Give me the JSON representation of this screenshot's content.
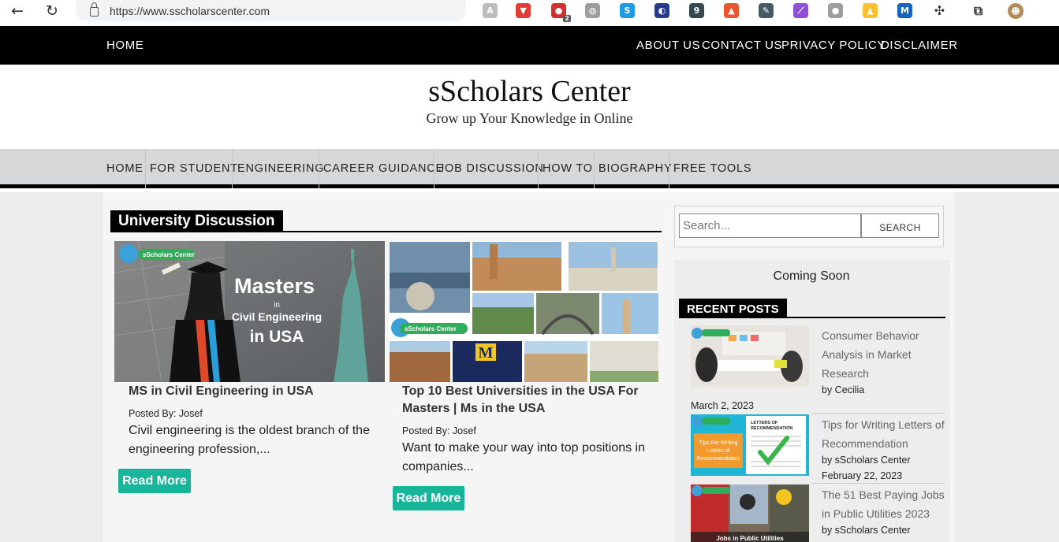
{
  "browser": {
    "url": "https://www.sscholarscenter.com",
    "extensions": [
      {
        "icon": "a-logo-icon",
        "color": "#bdbdbd",
        "glyph": "A"
      },
      {
        "icon": "shield-icon",
        "color": "#e53935",
        "glyph": "▼"
      },
      {
        "icon": "adblock-icon",
        "color": "#d32f2f",
        "glyph": "●",
        "badge": "2"
      },
      {
        "icon": "globe-icon",
        "color": "#9e9e9e",
        "glyph": "◍"
      },
      {
        "icon": "skype-icon",
        "color": "#1e9be7",
        "glyph": "S"
      },
      {
        "icon": "swirl-icon",
        "color": "#263b8a",
        "glyph": "◐"
      },
      {
        "icon": "nine-icon",
        "color": "#37474f",
        "glyph": "9"
      },
      {
        "icon": "lock-icon",
        "color": "#e8552e",
        "glyph": "▲"
      },
      {
        "icon": "pen-icon",
        "color": "#455a64",
        "glyph": "✎"
      },
      {
        "icon": "feather-icon",
        "color": "#8e4fd6",
        "glyph": "⟋"
      },
      {
        "icon": "circle-icon",
        "color": "#9e9e9e",
        "glyph": "●"
      },
      {
        "icon": "bell-icon",
        "color": "#fbc02d",
        "glyph": "▲"
      },
      {
        "icon": "m-icon",
        "color": "#1565c0",
        "glyph": "M"
      },
      {
        "icon": "puzzle-icon",
        "color": "#ffffff",
        "glyph": "✣"
      },
      {
        "icon": "collections-icon",
        "color": "#ffffff",
        "glyph": "⧉"
      },
      {
        "icon": "avatar",
        "color": "#b58b5a",
        "glyph": "☻"
      }
    ]
  },
  "top_nav": {
    "home": "HOME",
    "about": "ABOUT US",
    "contact": "CONTACT US",
    "privacy": "PRIVACY POLICY",
    "disclaimer": "DISCLAIMER"
  },
  "header": {
    "title": "sScholars Center",
    "tagline": "Grow up Your Knowledge in Online"
  },
  "main_menu": [
    "HOME",
    "FOR STUDENT",
    "ENGINEERING",
    "CAREER GUIDANCE",
    "JOB DISCUSSION",
    "HOW TO",
    "BIOGRAPHY",
    "FREE TOOLS"
  ],
  "section": {
    "title": "University Discussion"
  },
  "posts": [
    {
      "thumb_text": {
        "brand": "sScholars Center",
        "line1": "Masters",
        "line2": "in",
        "line3": "Civil Engineering",
        "line4": "in USA"
      },
      "title": "MS in Civil Engineering in USA",
      "posted_by": "Posted By: Josef",
      "excerpt": "Civil engineering is the oldest branch of the engineering profession,...",
      "read_more": "Read More"
    },
    {
      "thumb_text": {
        "brand": "sScholars Center",
        "banner": "M"
      },
      "title": "Top 10 Best Universities in the USA For Masters | Ms in the USA",
      "posted_by": "Posted By: Josef",
      "excerpt": "Want to make your way into top positions in companies...",
      "read_more": "Read More"
    }
  ],
  "sidebar": {
    "search_placeholder": "Search...",
    "search_button": "SEARCH",
    "coming_soon": "Coming Soon",
    "recent_title": "RECENT POSTS",
    "recent_posts": [
      {
        "title": "Consumer Behavior Analysis in Market Research",
        "by": "by Cecilia",
        "date": "March 2, 2023"
      },
      {
        "title": "Tips for Writing Letters of Recommendation",
        "by": "by sScholars Center",
        "date": "February 22, 2023",
        "thumb_text": {
          "a": "Tips For Writing",
          "b": "Letters of",
          "c": "Recommendation",
          "d": "LETTERS OF",
          "e": "RECOMMENDATION"
        }
      },
      {
        "title": "The 51 Best Paying Jobs in Public Utilities 2023",
        "by": "by sScholars Center",
        "thumb_text": {
          "a": "Jobs in Public Utilities"
        }
      }
    ]
  },
  "colors": {
    "accent": "#17b69a",
    "nav_bg": "#000000",
    "menu_bg": "#d6d7d8"
  }
}
